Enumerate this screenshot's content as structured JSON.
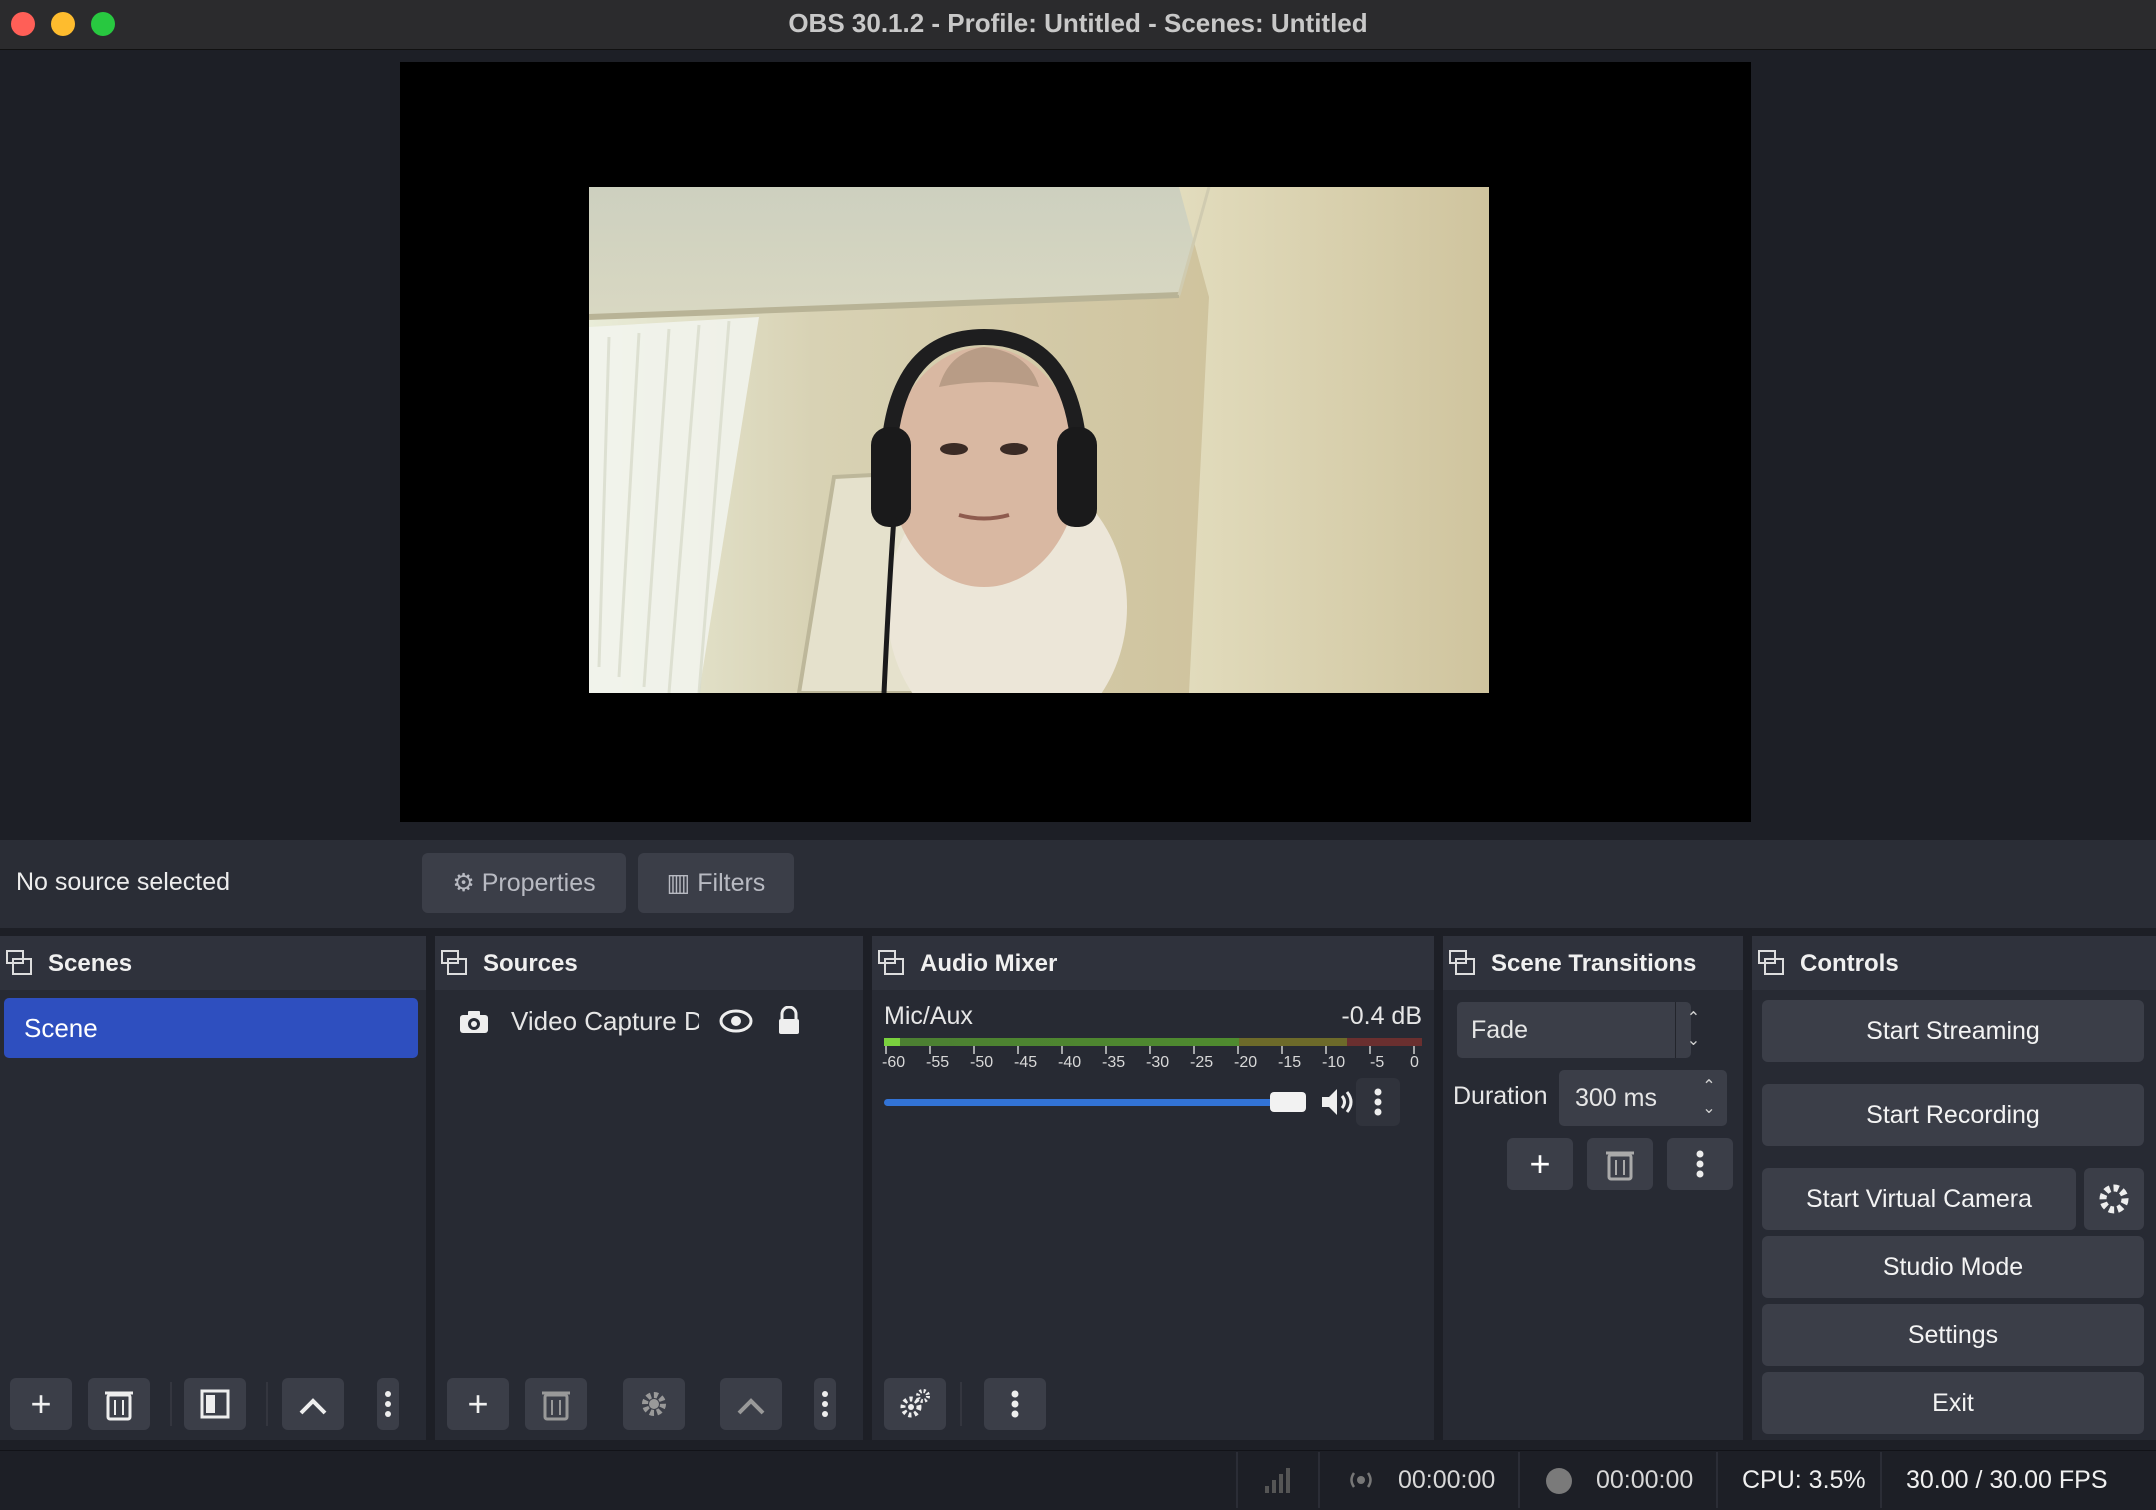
{
  "window": {
    "title": "OBS 30.1.2 - Profile: Untitled - Scenes: Untitled"
  },
  "context_bar": {
    "no_source": "No source selected",
    "properties_label": "Properties",
    "filters_label": "Filters"
  },
  "scenes": {
    "title": "Scenes",
    "items": [
      {
        "label": "Scene",
        "selected": true
      }
    ]
  },
  "sources": {
    "title": "Sources",
    "items": [
      {
        "label": "Video Capture Device",
        "visible": true,
        "locked": true
      }
    ]
  },
  "audio_mixer": {
    "title": "Audio Mixer",
    "channels": [
      {
        "name": "Mic/Aux",
        "db": "-0.4 dB",
        "volume_fraction": 0.95
      }
    ],
    "scale": [
      "-60",
      "-55",
      "-50",
      "-45",
      "-40",
      "-35",
      "-30",
      "-25",
      "-20",
      "-15",
      "-10",
      "-5",
      "0"
    ]
  },
  "transitions": {
    "title": "Scene Transitions",
    "selected": "Fade",
    "duration_label": "Duration",
    "duration_value": "300 ms"
  },
  "controls": {
    "title": "Controls",
    "start_streaming": "Start Streaming",
    "start_recording": "Start Recording",
    "start_virtual_camera": "Start Virtual Camera",
    "studio_mode": "Studio Mode",
    "settings": "Settings",
    "exit": "Exit"
  },
  "status": {
    "stream_time": "00:00:00",
    "record_time": "00:00:00",
    "cpu": "CPU: 3.5%",
    "fps": "30.00 / 30.00 FPS"
  },
  "colors": {
    "accent": "#2e4fbf",
    "fader": "#3273d6",
    "button": "#3b3e48",
    "dock": "#272a33"
  }
}
